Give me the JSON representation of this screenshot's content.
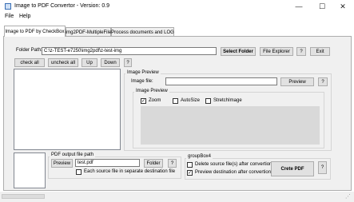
{
  "window": {
    "title": "Image to PDF Convertor - Version: 0.9",
    "minimize_glyph": "—",
    "maximize_glyph": "☐",
    "close_glyph": "✕"
  },
  "menu": {
    "items": [
      "File",
      "Help"
    ]
  },
  "tabs": [
    {
      "label": "Image to PDF by CheckBox"
    },
    {
      "label": "img2PDF-MultipleFile"
    },
    {
      "label": "Process documents and LOG"
    }
  ],
  "folder": {
    "label": "Folder Path:",
    "path_value": "C:\\z-TEST-e7250\\img2pdf\\z-test-img",
    "select_label": "Select Folder",
    "explorer_label": "File Explorer",
    "help_label": "?",
    "exit_label": "Exit"
  },
  "list_controls": {
    "check_all": "check all",
    "uncheck_all": "uncheck all",
    "up": "Up",
    "down": "Down",
    "help": "?"
  },
  "image_preview": {
    "group_title": "Image Preview",
    "file_label": "Image file:",
    "file_value": "",
    "preview_label": "Preview",
    "help_label": "?",
    "inner_title": "Image Preview",
    "zoom_label": "Zoom",
    "zoom_checked": true,
    "autosize_label": "AutoSize",
    "autosize_checked": false,
    "stretch_label": "StretchImage",
    "stretch_checked": false
  },
  "pdf_output": {
    "group_title": "PDF output file path",
    "preview_label": "Preview",
    "file_value": "test.pdf",
    "folder_label": "Folder",
    "help_label": "?",
    "separate_label": "Each source file in separate destination file",
    "separate_checked": false
  },
  "groupbox4": {
    "title": "groupBox4",
    "delete_label": "Delete source file(s) after convertion",
    "delete_checked": false,
    "preview_dest_label": "Preview destination after convertion",
    "preview_dest_checked": true,
    "create_label": "Crete PDF",
    "help_label": "?"
  },
  "check_mark": "✓"
}
